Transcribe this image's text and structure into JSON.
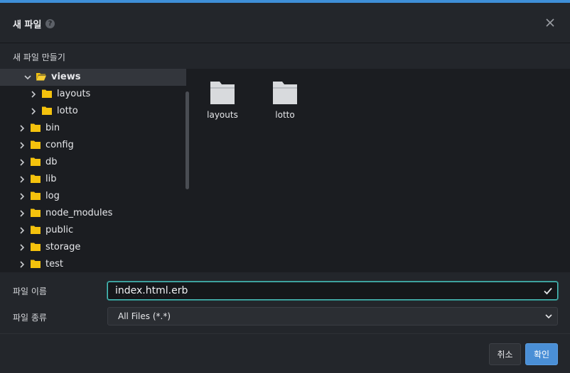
{
  "dialog": {
    "title": "새 파일",
    "help_icon": "question-icon",
    "close_icon": "close-icon",
    "subtitle": "새 파일 만들기"
  },
  "tree": {
    "items": [
      {
        "label": "views",
        "expanded": true,
        "selected": true
      },
      {
        "label": "layouts"
      },
      {
        "label": "lotto"
      },
      {
        "label": "bin"
      },
      {
        "label": "config"
      },
      {
        "label": "db"
      },
      {
        "label": "lib"
      },
      {
        "label": "log"
      },
      {
        "label": "node_modules"
      },
      {
        "label": "public"
      },
      {
        "label": "storage"
      },
      {
        "label": "test"
      }
    ]
  },
  "files": {
    "items": [
      {
        "label": "layouts",
        "icon": "folder-icon"
      },
      {
        "label": "lotto",
        "icon": "folder-icon"
      }
    ]
  },
  "form": {
    "name_label": "파일 이름",
    "name_value": "index.html.erb",
    "type_label": "파일 종류",
    "type_value": "All Files (*.*)"
  },
  "footer": {
    "cancel_label": "취소",
    "ok_label": "확인"
  },
  "colors": {
    "accent": "#4a8fd6",
    "folder": "#f4c20d",
    "focus_border": "#4cc4c0"
  }
}
